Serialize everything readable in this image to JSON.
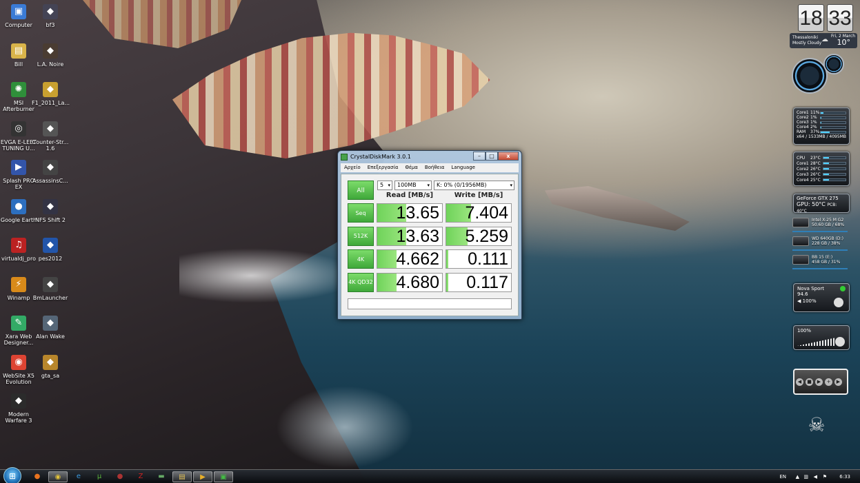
{
  "desktop": {
    "icons": [
      {
        "label": "Computer",
        "icon": "computer-icon",
        "glyph": "▣",
        "color": "#3a7bd5"
      },
      {
        "label": "bf3",
        "icon": "game-icon",
        "glyph": "◆",
        "color": "#445"
      },
      {
        "label": "Bill",
        "icon": "folder-icon",
        "glyph": "▤",
        "color": "#d9b44a"
      },
      {
        "label": "L.A. Noire",
        "icon": "game-icon",
        "glyph": "◆",
        "color": "#4a3c32"
      },
      {
        "label": "MSI Afterburner",
        "icon": "afterburner-icon",
        "glyph": "✺",
        "color": "#2f8f3a"
      },
      {
        "label": "F1_2011_La...",
        "icon": "game-icon",
        "glyph": "◆",
        "color": "#c8a030"
      },
      {
        "label": "EVGA E-LEET TUNING U...",
        "icon": "evga-icon",
        "glyph": "◎",
        "color": "#333"
      },
      {
        "label": "Counter-Str... 1.6",
        "icon": "game-icon",
        "glyph": "◆",
        "color": "#555"
      },
      {
        "label": "Splash PRO EX",
        "icon": "video-icon",
        "glyph": "▶",
        "color": "#3355aa"
      },
      {
        "label": "AssassinsC...",
        "icon": "game-icon",
        "glyph": "◆",
        "color": "#444"
      },
      {
        "label": "Google Earth",
        "icon": "globe-icon",
        "glyph": "●",
        "color": "#2d6fbf"
      },
      {
        "label": "NFS Shift 2",
        "icon": "game-icon",
        "glyph": "◆",
        "color": "#334"
      },
      {
        "label": "virtualdj_pro",
        "icon": "dj-icon",
        "glyph": "♫",
        "color": "#b22"
      },
      {
        "label": "pes2012",
        "icon": "game-icon",
        "glyph": "◆",
        "color": "#2255aa"
      },
      {
        "label": "Winamp",
        "icon": "winamp-icon",
        "glyph": "⚡",
        "color": "#d88a1a"
      },
      {
        "label": "BmLauncher",
        "icon": "game-icon",
        "glyph": "◆",
        "color": "#444"
      },
      {
        "label": "Xara Web Designer...",
        "icon": "xara-icon",
        "glyph": "✎",
        "color": "#3a6"
      },
      {
        "label": "Alan Wake",
        "icon": "game-icon",
        "glyph": "◆",
        "color": "#567"
      },
      {
        "label": "WebSite X5 Evolution",
        "icon": "website-icon",
        "glyph": "◉",
        "color": "#d43"
      },
      {
        "label": "gta_sa",
        "icon": "game-icon",
        "glyph": "◆",
        "color": "#b8862b"
      },
      {
        "label": "Modern Warfare 3",
        "icon": "game-icon",
        "glyph": "◆",
        "color": "#2b2b2b"
      }
    ]
  },
  "gadgets": {
    "clock": {
      "hour": "18",
      "minute": "33",
      "city": "Thessaloniki",
      "condition": "Mostly Cloudy",
      "date": "Fri, 2 March",
      "temp": "10°"
    },
    "cores": {
      "rows": [
        {
          "name": "Core1",
          "value": "11%",
          "level": 11
        },
        {
          "name": "Core2",
          "value": "1%",
          "level": 1
        },
        {
          "name": "Core3",
          "value": "1%",
          "level": 1
        },
        {
          "name": "Core4",
          "value": "2%",
          "level": 2
        },
        {
          "name": "RAM",
          "value": "37%",
          "level": 37
        }
      ],
      "footer": "x64 / 1533MB / 4095MB"
    },
    "temps": {
      "rows": [
        {
          "name": "CPU",
          "value": "23°C"
        },
        {
          "name": "Core1",
          "value": "28°C"
        },
        {
          "name": "Core2",
          "value": "26°C"
        },
        {
          "name": "Core3",
          "value": "26°C"
        },
        {
          "name": "Core4",
          "value": "25°C"
        }
      ]
    },
    "gpu": {
      "name": "GeForce GTX 275",
      "temp": "GPU: 50°C",
      "pcb": "PCB: 40°C"
    },
    "drives": [
      {
        "label": "Intel X-25 M G2",
        "detail": "50.60 GB / 68%"
      },
      {
        "label": "WD 640GB (D:)",
        "detail": "228 GB / 38%"
      },
      {
        "label": "BB 15 (E:)",
        "detail": "458 GB / 31%"
      }
    ],
    "radio": {
      "station": "Nova Sport",
      "freq": "94.6",
      "volume": "100%"
    },
    "volume": {
      "value": "100%"
    }
  },
  "cdm": {
    "title": "CrystalDiskMark 3.0.1",
    "menu": [
      "Αρχείο",
      "Επεξεργασία",
      "Θέμα",
      "Βοήθεια",
      "Language"
    ],
    "all_label": "All",
    "count": "5",
    "size": "100MB",
    "drive": "K: 0% (0/1956MB)",
    "read_header": "Read [MB/s]",
    "write_header": "Write [MB/s]",
    "rows": [
      {
        "label": "Seq",
        "read": "13.65",
        "write": "7.404",
        "read_fill": 0.45,
        "write_fill": 0.38
      },
      {
        "label": "512K",
        "read": "13.63",
        "write": "5.259",
        "read_fill": 0.45,
        "write_fill": 0.33
      },
      {
        "label": "4K",
        "read": "4.662",
        "write": "0.111",
        "read_fill": 0.3,
        "write_fill": 0.03
      },
      {
        "label": "4K QD32",
        "read": "4.680",
        "write": "0.117",
        "read_fill": 0.3,
        "write_fill": 0.03
      }
    ],
    "window_buttons": {
      "minimize": "–",
      "maximize": "□",
      "close": "x"
    }
  },
  "taskbar": {
    "start_glyph": "⊞",
    "items": [
      {
        "name": "firefox",
        "glyph": "●",
        "color": "#e8731f",
        "active": false
      },
      {
        "name": "chrome",
        "glyph": "◉",
        "color": "#e1c23a",
        "active": true
      },
      {
        "name": "ie",
        "glyph": "e",
        "color": "#3a9be0",
        "active": false
      },
      {
        "name": "utorrent",
        "glyph": "µ",
        "color": "#5ab33c",
        "active": false
      },
      {
        "name": "app",
        "glyph": "●",
        "color": "#a33",
        "active": false
      },
      {
        "name": "filezilla",
        "glyph": "Z",
        "color": "#c22",
        "active": false
      },
      {
        "name": "app2",
        "glyph": "▬",
        "color": "#6a6",
        "active": false
      },
      {
        "name": "explorer",
        "glyph": "▤",
        "color": "#e3c35a",
        "active": true
      },
      {
        "name": "media",
        "glyph": "▶",
        "color": "#e8b02a",
        "active": true
      },
      {
        "name": "crystaldiskmark",
        "glyph": "▣",
        "color": "#4b4",
        "active": true
      }
    ],
    "tray": {
      "lang": "EN",
      "time": "6:33 μμ"
    }
  }
}
